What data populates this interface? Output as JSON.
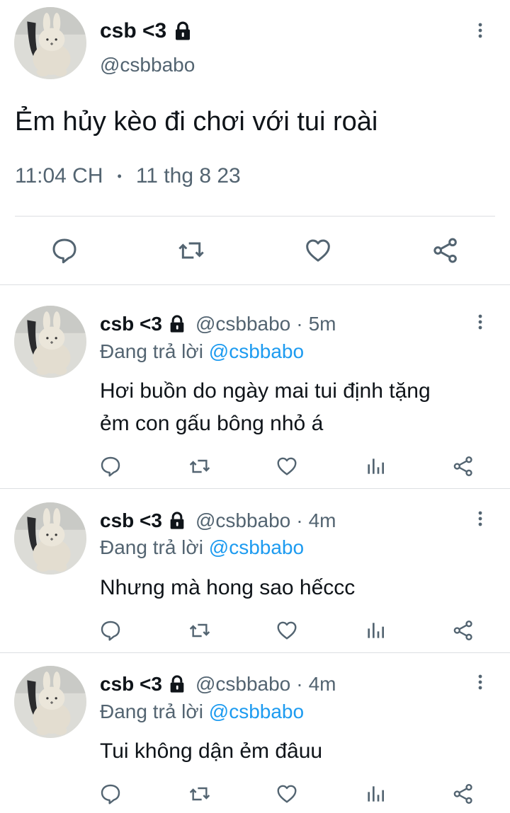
{
  "main_tweet": {
    "display_name": "csb <3",
    "handle": "@csbbabo",
    "text": "Ẻm hủy kèo đi chơi với tui roài",
    "time": "11:04 CH",
    "separator": "•",
    "date": "11 thg 8 23"
  },
  "replies": [
    {
      "display_name": "csb <3",
      "handle": "@csbbabo",
      "dot": "·",
      "age": "5m",
      "replying_prefix": "Đang trả lời ",
      "replying_to": "@csbbabo",
      "text_lines": [
        "Hơi buồn do ngày mai tui định tặng",
        "ẻm con gấu bông nhỏ á"
      ]
    },
    {
      "display_name": "csb <3",
      "handle": "@csbbabo",
      "dot": "·",
      "age": "4m",
      "replying_prefix": "Đang trả lời ",
      "replying_to": "@csbbabo",
      "text_lines": [
        "Nhưng mà hong sao hếccc"
      ]
    },
    {
      "display_name": "csb <3",
      "handle": "@csbbabo",
      "dot": "·",
      "age": "4m",
      "replying_prefix": "Đang trả lời ",
      "replying_to": "@csbbabo",
      "text_lines": [
        "Tui không dận ẻm đâuu"
      ]
    }
  ],
  "icons": {
    "lock": "lock-icon",
    "more": "more-vertical-icon",
    "reply": "reply-icon",
    "retweet": "retweet-icon",
    "like": "heart-icon",
    "views": "views-chart-icon",
    "share": "share-icon"
  },
  "colors": {
    "text": "#0f1419",
    "secondary": "#536471",
    "accent": "#1d9bf0",
    "divider": "#dcdfe2"
  }
}
